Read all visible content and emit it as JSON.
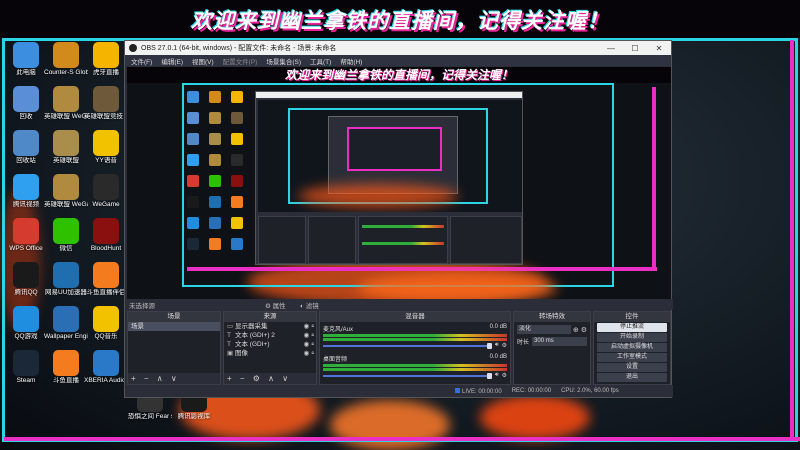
{
  "banner": {
    "text": "欢迎来到幽兰拿铁的直播间，记得关注喔！"
  },
  "desktop": {
    "icons": [
      {
        "label": "此电脑",
        "icon": "computer-icon",
        "color": "#3b8ee0"
      },
      {
        "label": "Counter-S Global Of...",
        "icon": "csgo-icon",
        "color": "#d18a1b"
      },
      {
        "label": "虎牙直播",
        "icon": "huya-icon",
        "color": "#f5b400"
      },
      {
        "label": "回收",
        "icon": "recycle-bin-icon",
        "color": "#5a8fd8"
      },
      {
        "label": "英雄联盟 WeGame版",
        "icon": "lol-icon",
        "color": "#b08a3e"
      },
      {
        "label": "英雄联盟竞技 助手",
        "icon": "helper-icon",
        "color": "#6e5a3a"
      },
      {
        "label": "回收站",
        "icon": "trash-icon",
        "color": "#4f89c8"
      },
      {
        "label": "英雄联盟",
        "icon": "lol-client-icon",
        "color": "#a98d4a"
      },
      {
        "label": "YY语音",
        "icon": "yy-icon",
        "color": "#f2c200"
      },
      {
        "label": "腾讯视频",
        "icon": "tencent-video-icon",
        "color": "#2fa0f0"
      },
      {
        "label": "英雄联盟 WeGame版",
        "icon": "lol-wegame-icon",
        "color": "#b08a3e"
      },
      {
        "label": "WeGame",
        "icon": "wegame-icon",
        "color": "#2a2a2a"
      },
      {
        "label": "WPS Office",
        "icon": "wps-icon",
        "color": "#d63b2f"
      },
      {
        "label": "微信",
        "icon": "wechat-icon",
        "color": "#2dc100"
      },
      {
        "label": "BloodHunt",
        "icon": "bloodhunt-icon",
        "color": "#8a1010"
      },
      {
        "label": "腾讯QQ",
        "icon": "qq-icon",
        "color": "#1a1a1a"
      },
      {
        "label": "网易UU加速器",
        "icon": "uu-icon",
        "color": "#1f6fb0"
      },
      {
        "label": "斗鱼直播伴侣",
        "icon": "douyu-icon",
        "color": "#f57c1e"
      },
      {
        "label": "QQ游戏",
        "icon": "qq-game-icon",
        "color": "#1f8de0"
      },
      {
        "label": "Wallpaper Engine:...",
        "icon": "wallpaper-engine-icon",
        "color": "#2a6fb5"
      },
      {
        "label": "QQ音乐",
        "icon": "qq-music-icon",
        "color": "#f2c200"
      },
      {
        "label": "Steam",
        "icon": "steam-icon",
        "color": "#1b2838"
      },
      {
        "label": "斗鱼直播",
        "icon": "douyu-live-icon",
        "color": "#f57c1e"
      },
      {
        "label": "XBERIA Audio...",
        "icon": "xberia-icon",
        "color": "#2a78c8"
      }
    ],
    "extra_icons": [
      {
        "label": "恐惧之间 Fear sur...",
        "icon": "fear-icon",
        "color": "#333333"
      },
      {
        "label": "腾讯影视库",
        "icon": "tencent-library-icon",
        "color": "#1a1a1a"
      }
    ]
  },
  "obs": {
    "title": "OBS 27.0.1 (64-bit, windows) - 配置文件: 未命名 - 场景: 未命名",
    "window_buttons": [
      "—",
      "☐",
      "✕"
    ],
    "menu": [
      "文件(F)",
      "编辑(E)",
      "视图(V)",
      "配置文件(P)",
      "场景集合(S)",
      "工具(T)",
      "帮助(H)"
    ],
    "tab_row": {
      "no_source": "未选择源",
      "properties": "属性",
      "filters": "滤镜"
    },
    "docks": {
      "scenes": {
        "title": "场景",
        "items": [
          "场景"
        ],
        "footer": "+ − ∧ ∨"
      },
      "sources": {
        "title": "来源",
        "items": [
          "显示器采集",
          "文本 (GDI+) 2",
          "文本 (GDI+)",
          "图像"
        ],
        "footer": "+ − ⚙ ∧ ∨"
      },
      "mixer": {
        "title": "混音器",
        "channels": [
          {
            "name": "麦克风/Aux",
            "db": "0.0 dB"
          },
          {
            "name": "桌面音频",
            "db": "0.0 dB"
          }
        ]
      },
      "transitions": {
        "title": "转场特效",
        "type": "淡化",
        "duration_label": "时长",
        "duration": "300 ms"
      },
      "controls": {
        "title": "控件",
        "buttons": [
          "停止推流",
          "开始录制",
          "启动虚拟摄像机",
          "工作室模式",
          "设置",
          "退出"
        ]
      }
    },
    "status": {
      "live": "LIVE: 00:00:00",
      "rec": "REC: 00:00:00",
      "cpu": "CPU: 2.0%, 60.00 fps"
    }
  },
  "colors": {
    "cyan": "#2bd5e6",
    "pink": "#ec2fc4"
  }
}
